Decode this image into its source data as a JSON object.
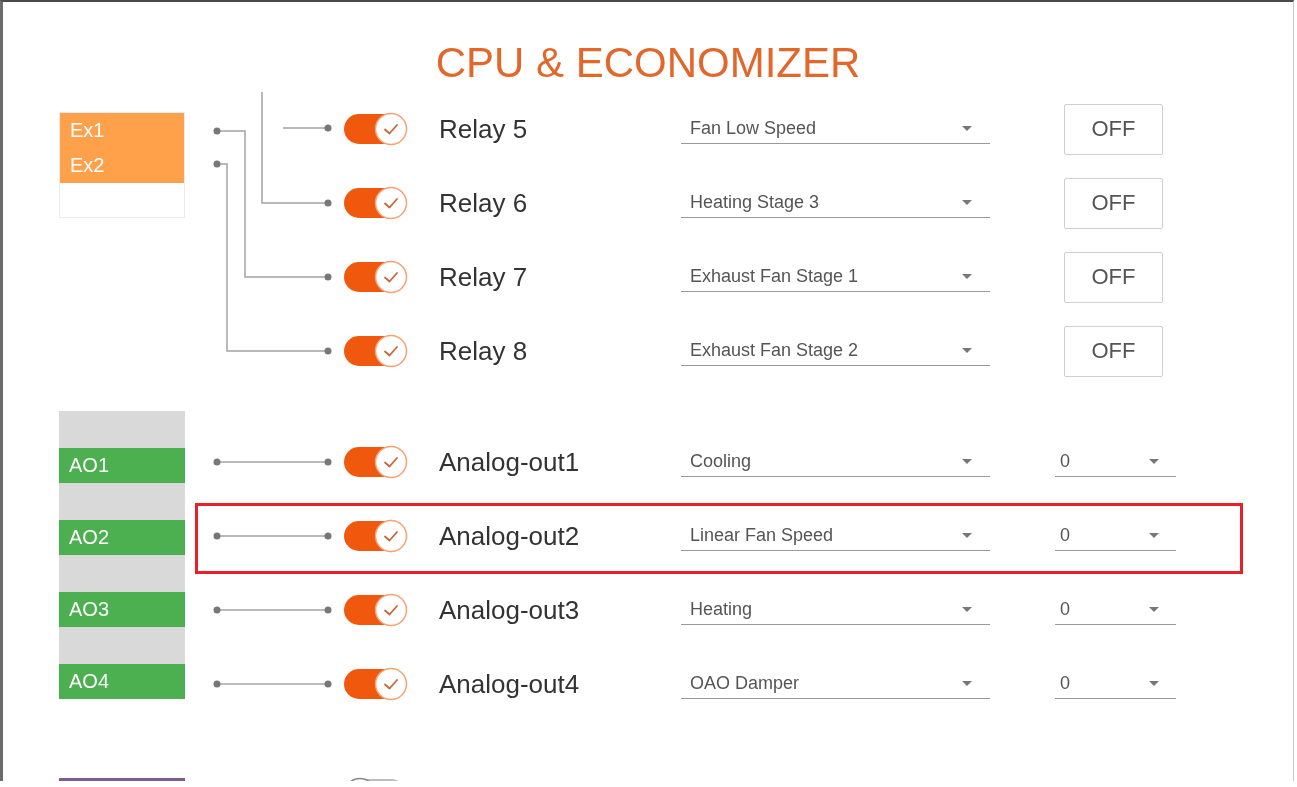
{
  "title": "CPU & ECONOMIZER",
  "sections": [
    {
      "kind": "relay",
      "ports": [
        {
          "label": "Ex1",
          "color": "#ffa04a"
        },
        {
          "label": "Ex2",
          "color": "#ffa04a"
        }
      ],
      "rows": [
        {
          "label": "Relay 5",
          "enabled": true,
          "function": "Fan Low Speed",
          "value": "OFF",
          "highlighted": false
        },
        {
          "label": "Relay 6",
          "enabled": true,
          "function": "Heating Stage 3",
          "value": "OFF",
          "highlighted": false
        },
        {
          "label": "Relay 7",
          "enabled": true,
          "function": "Exhaust Fan Stage 1",
          "value": "OFF",
          "highlighted": false
        },
        {
          "label": "Relay 8",
          "enabled": true,
          "function": "Exhaust Fan Stage 2",
          "value": "OFF",
          "highlighted": false
        }
      ]
    },
    {
      "kind": "analog",
      "ports": [
        {
          "label": "AO1",
          "color": "#4caf50"
        },
        {
          "label": "AO2",
          "color": "#4caf50"
        },
        {
          "label": "AO3",
          "color": "#4caf50"
        },
        {
          "label": "AO4",
          "color": "#4caf50"
        }
      ],
      "rows": [
        {
          "label": "Analog-out1",
          "enabled": true,
          "function": "Cooling",
          "value": "0",
          "highlighted": false
        },
        {
          "label": "Analog-out2",
          "enabled": true,
          "function": "Linear Fan Speed",
          "value": "0",
          "highlighted": true
        },
        {
          "label": "Analog-out3",
          "enabled": true,
          "function": "Heating",
          "value": "0",
          "highlighted": false
        },
        {
          "label": "Analog-out4",
          "enabled": true,
          "function": "OAO Damper",
          "value": "0",
          "highlighted": false
        }
      ]
    },
    {
      "kind": "next",
      "ports": [
        {
          "color": "#7d5c8f"
        }
      ],
      "rows": [
        {
          "enabled": false,
          "highlighted": false
        }
      ]
    }
  ]
}
